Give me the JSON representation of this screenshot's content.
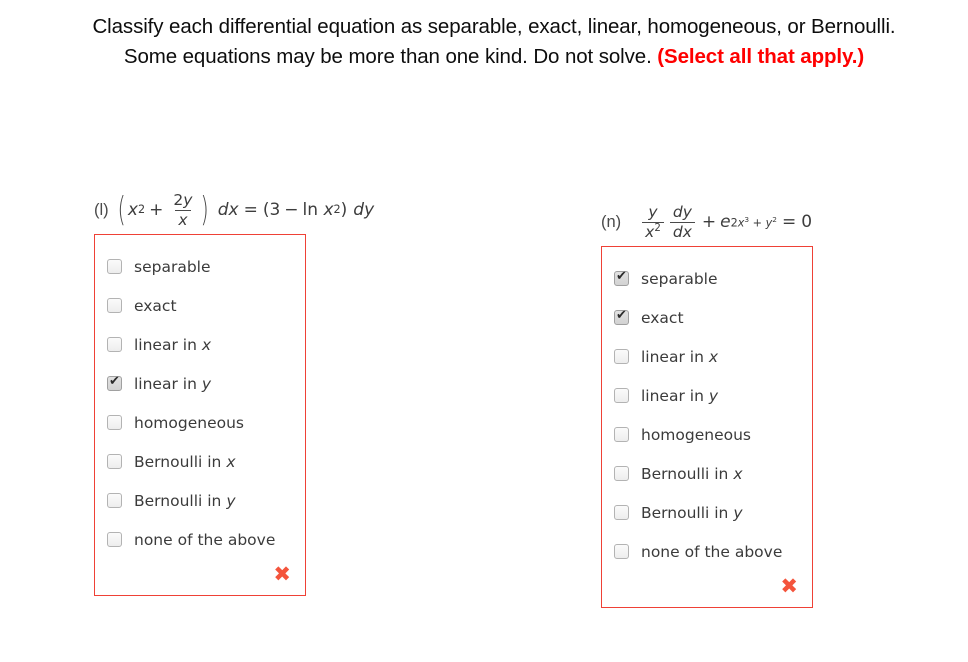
{
  "question": {
    "stem_part1": "Classify each differential equation as separable, exact, linear, homogeneous, or Bernoulli. Some equations may be more than one kind. Do not solve. ",
    "stem_select_all": "(Select all that apply.)",
    "stem_full": "Classify each differential equation as separable, exact, linear, homogeneous, or Bernoulli. Some equations may be more than one kind. Do not solve. (Select all that apply.)"
  },
  "colors": {
    "card_border": "#ef4136",
    "incorrect_mark": "#f4543c",
    "emphasis_red": "#ff0000",
    "text": "#3b3b3b",
    "background": "#ffffff"
  },
  "icons": {
    "incorrect": "✖",
    "check": "✔"
  },
  "parts": [
    {
      "label": "(l)",
      "equation_text": "(x² + 2y/x) dx = (3 − ln x²) dy",
      "equation": {
        "lhs_open": "(",
        "lhs_var": "x",
        "lhs_exp": "2",
        "lhs_op": "+",
        "frac_num_coeff": "2",
        "frac_num_var": "y",
        "frac_den": "x",
        "lhs_close": ")",
        "lhs_diff": "dx",
        "equals": "=",
        "rhs_open": "(",
        "rhs_const": "3",
        "rhs_op": "−",
        "rhs_fn": "ln",
        "rhs_var": "x",
        "rhs_exp": "2",
        "rhs_close": ")",
        "rhs_diff": "dy"
      },
      "choices": [
        {
          "label": "separable",
          "var": "",
          "checked": false
        },
        {
          "label": "exact",
          "var": "",
          "checked": false
        },
        {
          "label": "linear in ",
          "var": "x",
          "checked": false
        },
        {
          "label": "linear in ",
          "var": "y",
          "checked": true
        },
        {
          "label": "homogeneous",
          "var": "",
          "checked": false
        },
        {
          "label": "Bernoulli in ",
          "var": "x",
          "checked": false
        },
        {
          "label": "Bernoulli in ",
          "var": "y",
          "checked": false
        },
        {
          "label": "none of the above",
          "var": "",
          "checked": false
        }
      ],
      "result_mark": "✖"
    },
    {
      "label": "(n)",
      "equation_text": "(y/x²)(dy/dx) + e^(2x³ + y²) = 0",
      "equation": {
        "frac1_num": "y",
        "frac1_den_var": "x",
        "frac1_den_exp": "2",
        "frac2_num": "dy",
        "frac2_den": "dx",
        "op": "+",
        "base": "e",
        "exp_coeff": "2",
        "exp_var1": "x",
        "exp_var1_pow": "3",
        "exp_op": "+",
        "exp_var2": "y",
        "exp_var2_pow": "2",
        "equals": "=",
        "rhs": "0"
      },
      "choices": [
        {
          "label": "separable",
          "var": "",
          "checked": true
        },
        {
          "label": "exact",
          "var": "",
          "checked": true
        },
        {
          "label": "linear in ",
          "var": "x",
          "checked": false
        },
        {
          "label": "linear in ",
          "var": "y",
          "checked": false
        },
        {
          "label": "homogeneous",
          "var": "",
          "checked": false
        },
        {
          "label": "Bernoulli in ",
          "var": "x",
          "checked": false
        },
        {
          "label": "Bernoulli in ",
          "var": "y",
          "checked": false
        },
        {
          "label": "none of the above",
          "var": "",
          "checked": false
        }
      ],
      "result_mark": "✖"
    }
  ]
}
